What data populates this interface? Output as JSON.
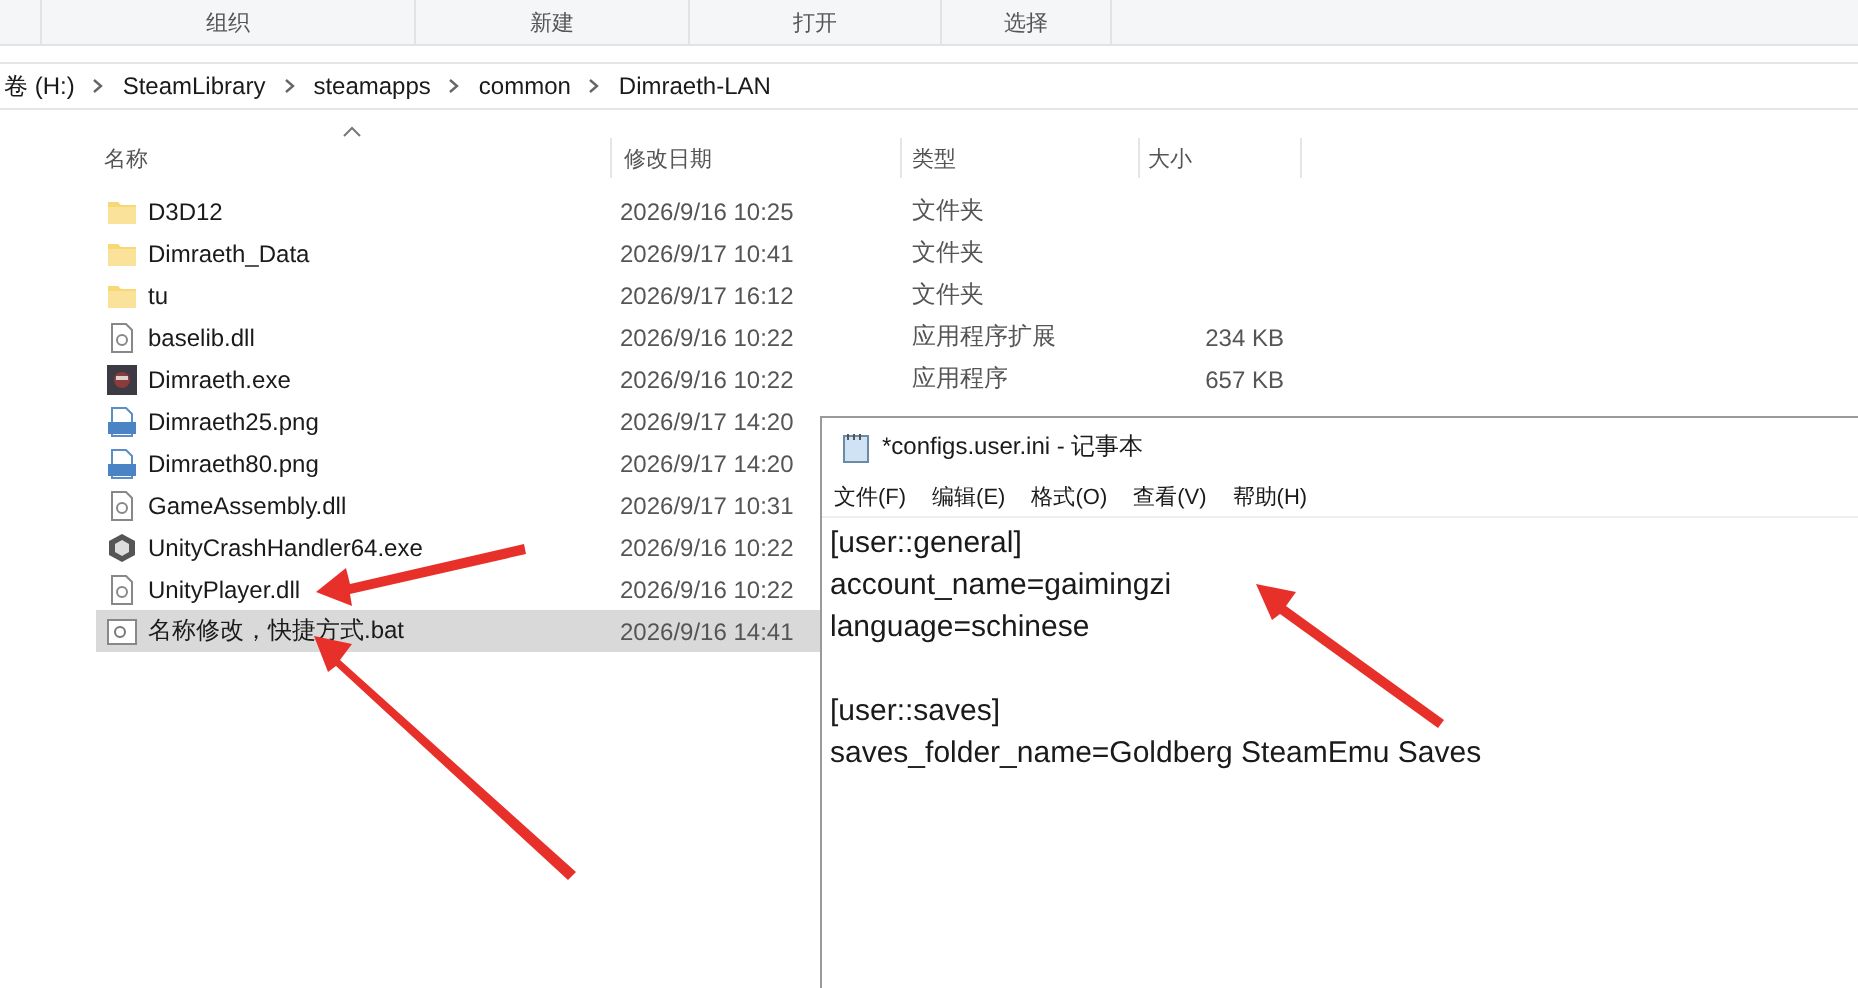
{
  "ribbon_groups": [
    "组织",
    "新建",
    "打开",
    "选择"
  ],
  "breadcrumb": [
    "卷 (H:)",
    "SteamLibrary",
    "steamapps",
    "common",
    "Dimraeth-LAN"
  ],
  "columns": [
    "名称",
    "修改日期",
    "类型",
    "大小"
  ],
  "files": [
    {
      "kind": "folder",
      "name": "D3D12",
      "date": "2026/9/16 10:25",
      "type": "文件夹",
      "selected": false
    },
    {
      "kind": "folder",
      "name": "Dimraeth_Data",
      "date": "2026/9/17 10:41",
      "type": "文件夹",
      "selected": false
    },
    {
      "kind": "folder",
      "name": "tu",
      "date": "2026/9/17 16:12",
      "type": "文件夹",
      "selected": false
    },
    {
      "kind": "dll",
      "name": "baselib.dll",
      "date": "2026/9/16 10:22",
      "type": "应用程序扩展",
      "size": "234 KB",
      "selected": false
    },
    {
      "kind": "game",
      "name": "Dimraeth.exe",
      "date": "2026/9/16 10:22",
      "type": "应用程序",
      "size": "657 KB",
      "selected": false
    },
    {
      "kind": "png",
      "name": "Dimraeth25.png",
      "date": "2026/9/17 14:20",
      "selected": false
    },
    {
      "kind": "png",
      "name": "Dimraeth80.png",
      "date": "2026/9/17 14:20",
      "selected": false
    },
    {
      "kind": "dll",
      "name": "GameAssembly.dll",
      "date": "2026/9/17 10:31",
      "selected": false
    },
    {
      "kind": "unity",
      "name": "UnityCrashHandler64.exe",
      "date": "2026/9/16 10:22",
      "selected": false
    },
    {
      "kind": "dll",
      "name": "UnityPlayer.dll",
      "date": "2026/9/16 10:22",
      "selected": false
    },
    {
      "kind": "bat",
      "name": "名称修改，快捷方式.bat",
      "date": "2026/9/16 14:41",
      "selected": true
    }
  ],
  "notepad": {
    "title": "*configs.user.ini - 记事本",
    "menu": [
      "文件(F)",
      "编辑(E)",
      "格式(O)",
      "查看(V)",
      "帮助(H)"
    ],
    "sections": [
      [
        "[user::general]",
        "account_name=gaimingzi",
        "language=schinese"
      ],
      [
        "[user::saves]",
        "saves_folder_name=Goldberg SteamEmu Saves"
      ]
    ]
  }
}
